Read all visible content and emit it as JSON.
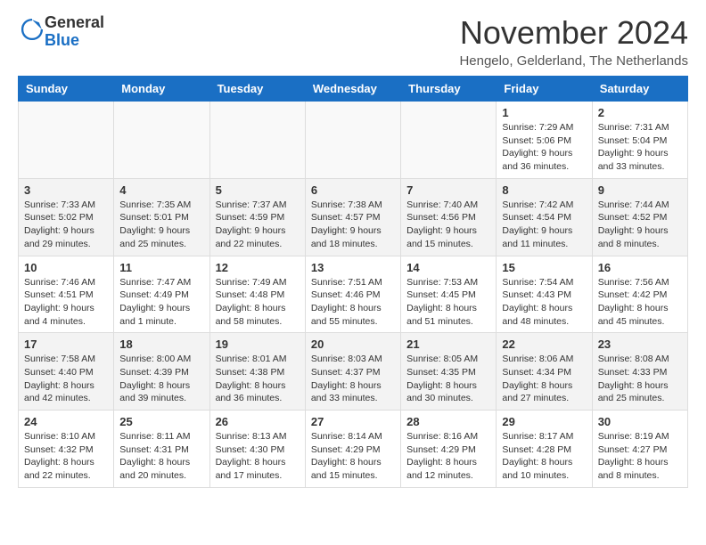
{
  "logo": {
    "text_general": "General",
    "text_blue": "Blue"
  },
  "header": {
    "month_title": "November 2024",
    "location": "Hengelo, Gelderland, The Netherlands"
  },
  "days_of_week": [
    "Sunday",
    "Monday",
    "Tuesday",
    "Wednesday",
    "Thursday",
    "Friday",
    "Saturday"
  ],
  "weeks": [
    [
      {
        "day": "",
        "info": ""
      },
      {
        "day": "",
        "info": ""
      },
      {
        "day": "",
        "info": ""
      },
      {
        "day": "",
        "info": ""
      },
      {
        "day": "",
        "info": ""
      },
      {
        "day": "1",
        "info": "Sunrise: 7:29 AM\nSunset: 5:06 PM\nDaylight: 9 hours and 36 minutes."
      },
      {
        "day": "2",
        "info": "Sunrise: 7:31 AM\nSunset: 5:04 PM\nDaylight: 9 hours and 33 minutes."
      }
    ],
    [
      {
        "day": "3",
        "info": "Sunrise: 7:33 AM\nSunset: 5:02 PM\nDaylight: 9 hours and 29 minutes."
      },
      {
        "day": "4",
        "info": "Sunrise: 7:35 AM\nSunset: 5:01 PM\nDaylight: 9 hours and 25 minutes."
      },
      {
        "day": "5",
        "info": "Sunrise: 7:37 AM\nSunset: 4:59 PM\nDaylight: 9 hours and 22 minutes."
      },
      {
        "day": "6",
        "info": "Sunrise: 7:38 AM\nSunset: 4:57 PM\nDaylight: 9 hours and 18 minutes."
      },
      {
        "day": "7",
        "info": "Sunrise: 7:40 AM\nSunset: 4:56 PM\nDaylight: 9 hours and 15 minutes."
      },
      {
        "day": "8",
        "info": "Sunrise: 7:42 AM\nSunset: 4:54 PM\nDaylight: 9 hours and 11 minutes."
      },
      {
        "day": "9",
        "info": "Sunrise: 7:44 AM\nSunset: 4:52 PM\nDaylight: 9 hours and 8 minutes."
      }
    ],
    [
      {
        "day": "10",
        "info": "Sunrise: 7:46 AM\nSunset: 4:51 PM\nDaylight: 9 hours and 4 minutes."
      },
      {
        "day": "11",
        "info": "Sunrise: 7:47 AM\nSunset: 4:49 PM\nDaylight: 9 hours and 1 minute."
      },
      {
        "day": "12",
        "info": "Sunrise: 7:49 AM\nSunset: 4:48 PM\nDaylight: 8 hours and 58 minutes."
      },
      {
        "day": "13",
        "info": "Sunrise: 7:51 AM\nSunset: 4:46 PM\nDaylight: 8 hours and 55 minutes."
      },
      {
        "day": "14",
        "info": "Sunrise: 7:53 AM\nSunset: 4:45 PM\nDaylight: 8 hours and 51 minutes."
      },
      {
        "day": "15",
        "info": "Sunrise: 7:54 AM\nSunset: 4:43 PM\nDaylight: 8 hours and 48 minutes."
      },
      {
        "day": "16",
        "info": "Sunrise: 7:56 AM\nSunset: 4:42 PM\nDaylight: 8 hours and 45 minutes."
      }
    ],
    [
      {
        "day": "17",
        "info": "Sunrise: 7:58 AM\nSunset: 4:40 PM\nDaylight: 8 hours and 42 minutes."
      },
      {
        "day": "18",
        "info": "Sunrise: 8:00 AM\nSunset: 4:39 PM\nDaylight: 8 hours and 39 minutes."
      },
      {
        "day": "19",
        "info": "Sunrise: 8:01 AM\nSunset: 4:38 PM\nDaylight: 8 hours and 36 minutes."
      },
      {
        "day": "20",
        "info": "Sunrise: 8:03 AM\nSunset: 4:37 PM\nDaylight: 8 hours and 33 minutes."
      },
      {
        "day": "21",
        "info": "Sunrise: 8:05 AM\nSunset: 4:35 PM\nDaylight: 8 hours and 30 minutes."
      },
      {
        "day": "22",
        "info": "Sunrise: 8:06 AM\nSunset: 4:34 PM\nDaylight: 8 hours and 27 minutes."
      },
      {
        "day": "23",
        "info": "Sunrise: 8:08 AM\nSunset: 4:33 PM\nDaylight: 8 hours and 25 minutes."
      }
    ],
    [
      {
        "day": "24",
        "info": "Sunrise: 8:10 AM\nSunset: 4:32 PM\nDaylight: 8 hours and 22 minutes."
      },
      {
        "day": "25",
        "info": "Sunrise: 8:11 AM\nSunset: 4:31 PM\nDaylight: 8 hours and 20 minutes."
      },
      {
        "day": "26",
        "info": "Sunrise: 8:13 AM\nSunset: 4:30 PM\nDaylight: 8 hours and 17 minutes."
      },
      {
        "day": "27",
        "info": "Sunrise: 8:14 AM\nSunset: 4:29 PM\nDaylight: 8 hours and 15 minutes."
      },
      {
        "day": "28",
        "info": "Sunrise: 8:16 AM\nSunset: 4:29 PM\nDaylight: 8 hours and 12 minutes."
      },
      {
        "day": "29",
        "info": "Sunrise: 8:17 AM\nSunset: 4:28 PM\nDaylight: 8 hours and 10 minutes."
      },
      {
        "day": "30",
        "info": "Sunrise: 8:19 AM\nSunset: 4:27 PM\nDaylight: 8 hours and 8 minutes."
      }
    ]
  ]
}
